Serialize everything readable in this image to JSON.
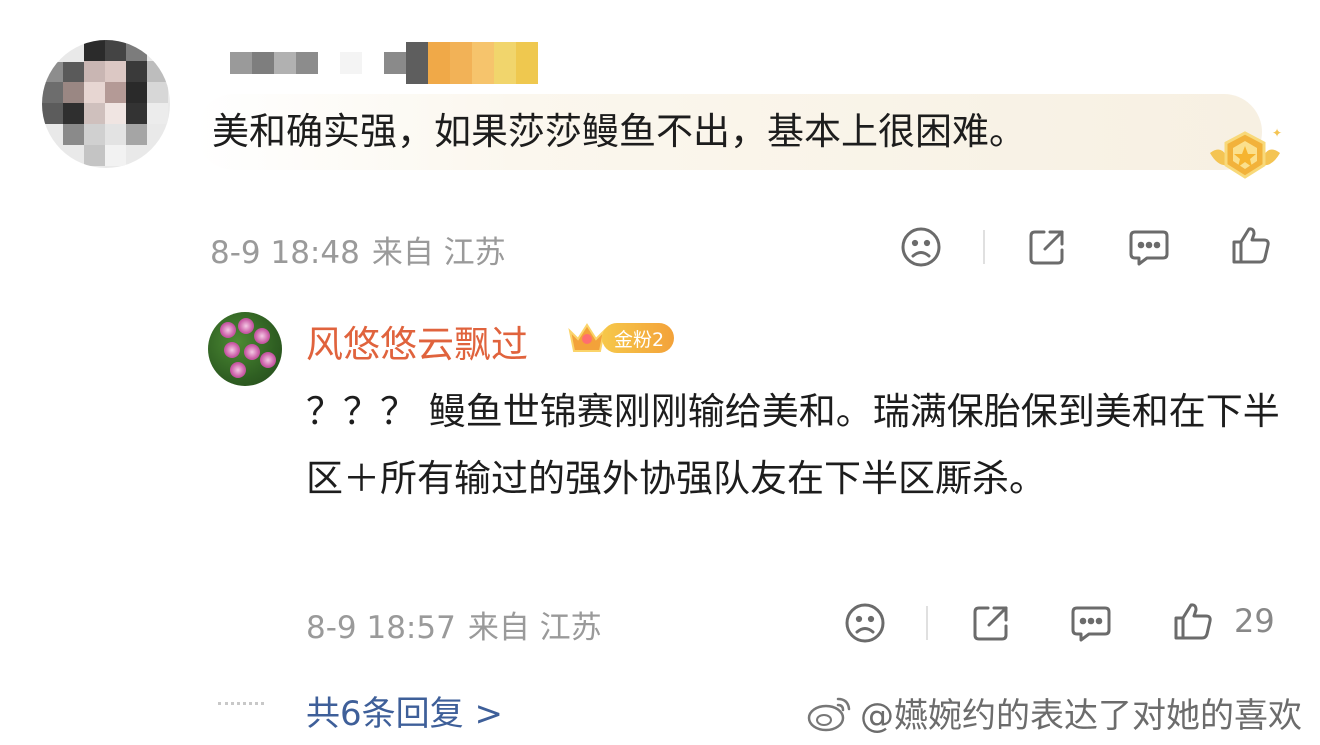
{
  "main_comment": {
    "text": "美和确实强，如果莎莎鳗鱼不出，基本上很困难。",
    "time": "8-9 18:48",
    "location": "来自 江苏",
    "icons": [
      "sad-face-icon",
      "share-icon",
      "comment-icon",
      "like-icon"
    ]
  },
  "reply": {
    "username": "风悠悠云飘过",
    "fan_badge": "金粉2",
    "text": "？？？ 鳗鱼世锦赛刚刚输给美和。瑞满保胎保到美和在下半区＋所有输过的强外协强队友在下半区厮杀。",
    "time": "8-9 18:57",
    "location": "来自 江苏",
    "like_count": "29"
  },
  "footer": {
    "more_replies": "共6条回复 >",
    "watermark": "@嬿婉约的表达了对她的喜欢"
  },
  "colors": {
    "username": "#e0633d",
    "link": "#3e5f99",
    "meta": "#9a9a9a",
    "badge": "#f3a23a"
  }
}
